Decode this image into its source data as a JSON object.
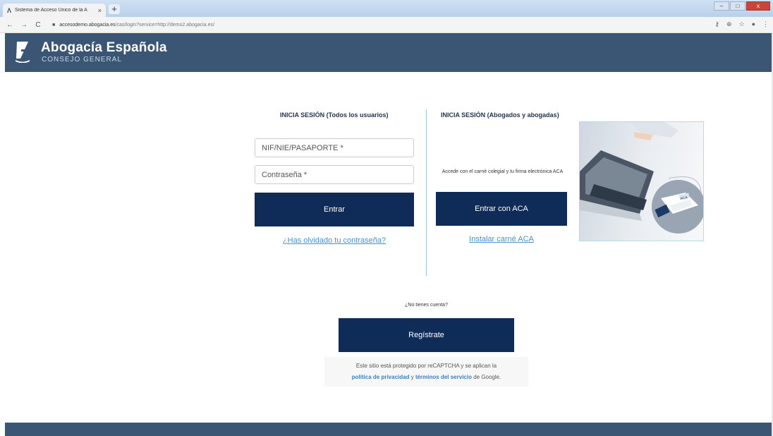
{
  "browser": {
    "tab_title": "Sistema de Acceso Único de la A",
    "tab_close": "×",
    "new_tab": "+",
    "url_host": "accesodemo.abogacia.es",
    "url_path": "/cas/login?service=http://demo2.abogacia.es/",
    "window_buttons": [
      "–",
      "□",
      "x"
    ]
  },
  "header": {
    "brand_name": "Abogacía Española",
    "brand_sub": "CONSEJO GENERAL",
    "background": "#3b5575"
  },
  "login": {
    "title": "INICIA SESIÓN (Todos los usuarios)",
    "id_placeholder": "NIF/NIE/PASAPORTE *",
    "password_placeholder": "Contraseña *",
    "submit_label": "Entrar",
    "forgot_link": "¿Has olvidado tu contraseña?"
  },
  "aca": {
    "title": "INICIA SESIÓN (Abogados y abogadas)",
    "description": "Accede con el carné colegial y tu firma electrónica ACA",
    "button_label": "Entrar con ACA",
    "install_link": "Instalar carné ACA",
    "card_label": "ACA"
  },
  "register": {
    "question": "¿No tienes cuenta?",
    "button_label": "Regístrate"
  },
  "recaptcha": {
    "line1": "Este sitio está protegido por reCAPTCHA y se aplican la",
    "privacy_link": "política de privacidad",
    "connector": "y",
    "terms_link": "términos del servicio",
    "suffix": "de Google."
  },
  "colors": {
    "primary_button": "#0f2b57",
    "link": "#4a90c8",
    "divider": "#9ec3de"
  }
}
